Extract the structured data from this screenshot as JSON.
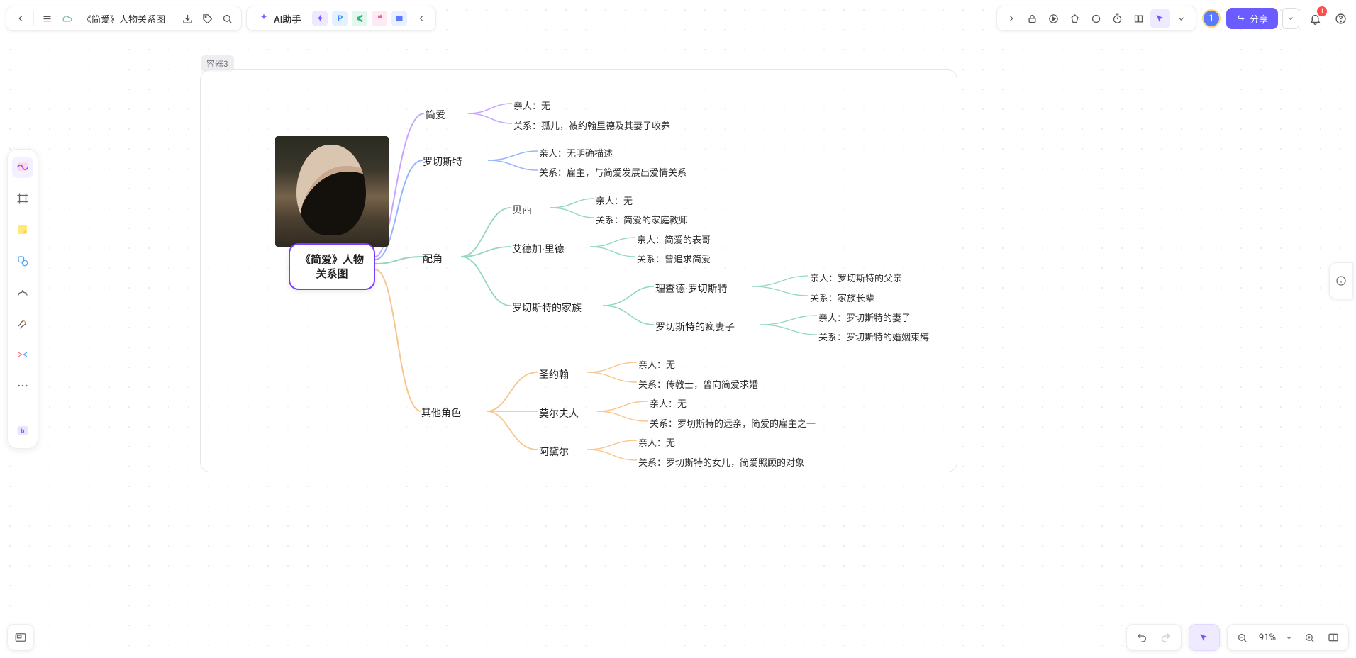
{
  "doc": {
    "title": "《简爱》人物关系图"
  },
  "ai": {
    "label": "AI助手"
  },
  "share": {
    "label": "分享"
  },
  "avatar": {
    "initial": "1"
  },
  "notifications": {
    "count": "1"
  },
  "zoom": {
    "label": "91%"
  },
  "container": {
    "label": "容器3"
  },
  "root": {
    "title": "《简爱》人物\n关系图"
  },
  "mindmap": {
    "branches": [
      {
        "id": "jane",
        "label": "简爱",
        "color": "#8a4bff",
        "leaves": [
          {
            "text": "亲人：无"
          },
          {
            "text": "关系：孤儿，被约翰里德及其妻子收养"
          }
        ]
      },
      {
        "id": "rochester",
        "label": "罗切斯特",
        "color": "#2e6bff",
        "leaves": [
          {
            "text": "亲人：无明确描述"
          },
          {
            "text": "关系：雇主，与简爱发展出爱情关系"
          }
        ]
      },
      {
        "id": "supporting",
        "label": "配角",
        "color": "#22b07d",
        "children": [
          {
            "id": "bessie",
            "label": "贝西",
            "leaves": [
              {
                "text": "亲人：无"
              },
              {
                "text": "关系：简爱的家庭教师"
              }
            ]
          },
          {
            "id": "edgar",
            "label": "艾德加·里德",
            "leaves": [
              {
                "text": "亲人：简爱的表哥"
              },
              {
                "text": "关系：曾追求简爱"
              }
            ]
          },
          {
            "id": "family",
            "label": "罗切斯特的家族",
            "children": [
              {
                "id": "richard",
                "label": "理查德·罗切斯特",
                "leaves": [
                  {
                    "text": "亲人：罗切斯特的父亲"
                  },
                  {
                    "text": "关系：家族长辈"
                  }
                ]
              },
              {
                "id": "madwife",
                "label": "罗切斯特的疯妻子",
                "leaves": [
                  {
                    "text": "亲人：罗切斯特的妻子"
                  },
                  {
                    "text": "关系：罗切斯特的婚姻束缚"
                  }
                ]
              }
            ]
          }
        ]
      },
      {
        "id": "others",
        "label": "其他角色",
        "color": "#f08c1a",
        "children": [
          {
            "id": "stjohn",
            "label": "圣约翰",
            "leaves": [
              {
                "text": "亲人：无"
              },
              {
                "text": "关系：传教士，曾向简爱求婚"
              }
            ]
          },
          {
            "id": "moore",
            "label": "莫尔夫人",
            "leaves": [
              {
                "text": "亲人：无"
              },
              {
                "text": "关系：罗切斯特的远亲，简爱的雇主之一"
              }
            ]
          },
          {
            "id": "adele",
            "label": "阿黛尔",
            "leaves": [
              {
                "text": "亲人：无"
              },
              {
                "text": "关系：罗切斯特的女儿，简爱照顾的对象"
              }
            ]
          }
        ]
      }
    ]
  }
}
